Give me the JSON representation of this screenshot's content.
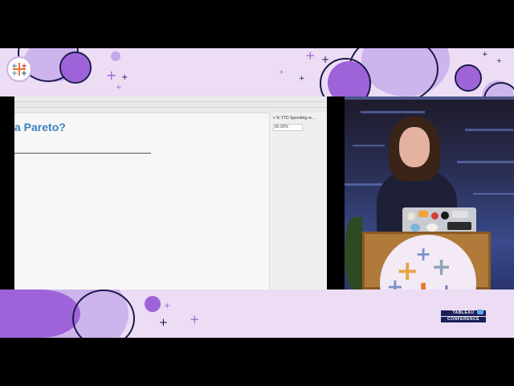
{
  "colors": {
    "band": "#ecdcf4",
    "purple": "#9e63d8",
    "navy": "#1a1a4a",
    "slide_title": "#3d7fc4"
  },
  "slide": {
    "title": "a Pareto?",
    "panel_field": "x % YTD Spending re...",
    "panel_value": "80.00%"
  },
  "logo": {
    "line1": "TABLEAU",
    "line2": "CONFERENCE"
  },
  "icons": [
    "tableau-logo-icon",
    "plus-icon"
  ]
}
